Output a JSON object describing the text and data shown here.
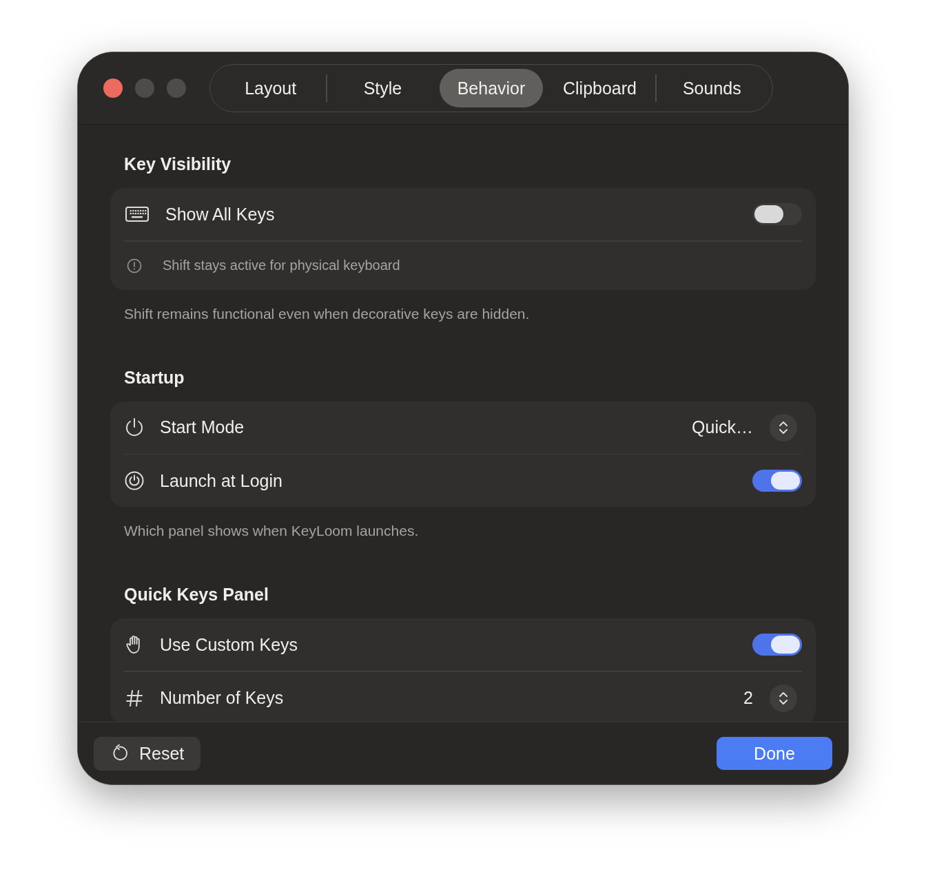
{
  "tabs": [
    {
      "label": "Layout",
      "selected": false
    },
    {
      "label": "Style",
      "selected": false
    },
    {
      "label": "Behavior",
      "selected": true
    },
    {
      "label": "Clipboard",
      "selected": false
    },
    {
      "label": "Sounds",
      "selected": false
    }
  ],
  "sections": [
    {
      "title": "Key Visibility",
      "rows": [
        {
          "kind": "toggle",
          "label": "Show All Keys",
          "on": false
        },
        {
          "kind": "note",
          "label": "Shift stays active for physical keyboard"
        }
      ],
      "footnote": "Shift remains functional even when decorative keys are hidden."
    },
    {
      "title": "Startup",
      "rows": [
        {
          "kind": "popup",
          "label": "Start Mode",
          "value": "Quick…"
        },
        {
          "kind": "toggle",
          "label": "Launch at Login",
          "on": true
        }
      ],
      "footnote": "Which panel shows when KeyLoom launches."
    },
    {
      "title": "Quick Keys Panel",
      "rows": [
        {
          "kind": "toggle",
          "label": "Use Custom Keys",
          "on": true
        },
        {
          "kind": "stepper",
          "label": "Number of Keys",
          "value": "2"
        }
      ]
    }
  ],
  "footer": {
    "reset": "Reset",
    "done": "Done"
  }
}
